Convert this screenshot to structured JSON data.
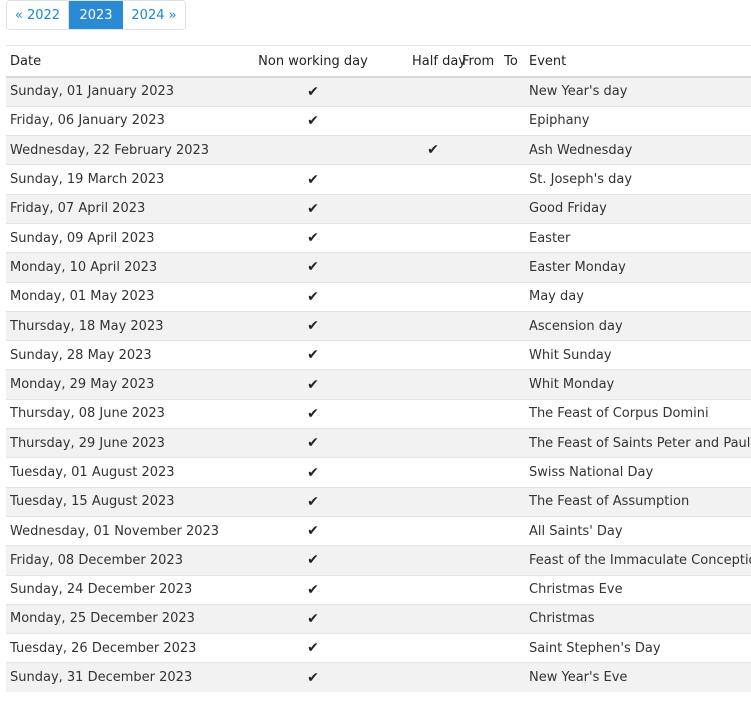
{
  "pagination": {
    "prev": "« 2022",
    "current": "2023",
    "next": "2024 »"
  },
  "table": {
    "headers": {
      "date": "Date",
      "non_working": "Non working day",
      "half_day": "Half day",
      "from": "From",
      "to": "To",
      "event": "Event"
    },
    "check_mark": "✔",
    "rows": [
      {
        "date": "Sunday, 01 January 2023",
        "non_working": "✔",
        "half_day": "",
        "from": "",
        "to": "",
        "event": "New Year's day"
      },
      {
        "date": "Friday, 06 January 2023",
        "non_working": "✔",
        "half_day": "",
        "from": "",
        "to": "",
        "event": "Epiphany"
      },
      {
        "date": "Wednesday, 22 February 2023",
        "non_working": "",
        "half_day": "✔",
        "from": "",
        "to": "",
        "event": "Ash Wednesday"
      },
      {
        "date": "Sunday, 19 March 2023",
        "non_working": "✔",
        "half_day": "",
        "from": "",
        "to": "",
        "event": "St. Joseph's day"
      },
      {
        "date": "Friday, 07 April 2023",
        "non_working": "✔",
        "half_day": "",
        "from": "",
        "to": "",
        "event": "Good Friday"
      },
      {
        "date": "Sunday, 09 April 2023",
        "non_working": "✔",
        "half_day": "",
        "from": "",
        "to": "",
        "event": "Easter"
      },
      {
        "date": "Monday, 10 April 2023",
        "non_working": "✔",
        "half_day": "",
        "from": "",
        "to": "",
        "event": "Easter Monday"
      },
      {
        "date": "Monday, 01 May 2023",
        "non_working": "✔",
        "half_day": "",
        "from": "",
        "to": "",
        "event": "May day"
      },
      {
        "date": "Thursday, 18 May 2023",
        "non_working": "✔",
        "half_day": "",
        "from": "",
        "to": "",
        "event": "Ascension day"
      },
      {
        "date": "Sunday, 28 May 2023",
        "non_working": "✔",
        "half_day": "",
        "from": "",
        "to": "",
        "event": "Whit Sunday"
      },
      {
        "date": "Monday, 29 May 2023",
        "non_working": "✔",
        "half_day": "",
        "from": "",
        "to": "",
        "event": "Whit Monday"
      },
      {
        "date": "Thursday, 08 June 2023",
        "non_working": "✔",
        "half_day": "",
        "from": "",
        "to": "",
        "event": "The Feast of Corpus Domini"
      },
      {
        "date": "Thursday, 29 June 2023",
        "non_working": "✔",
        "half_day": "",
        "from": "",
        "to": "",
        "event": "The Feast of Saints Peter and Paul"
      },
      {
        "date": "Tuesday, 01 August 2023",
        "non_working": "✔",
        "half_day": "",
        "from": "",
        "to": "",
        "event": "Swiss National Day"
      },
      {
        "date": "Tuesday, 15 August 2023",
        "non_working": "✔",
        "half_day": "",
        "from": "",
        "to": "",
        "event": "The Feast of Assumption"
      },
      {
        "date": "Wednesday, 01 November 2023",
        "non_working": "✔",
        "half_day": "",
        "from": "",
        "to": "",
        "event": "All Saints' Day"
      },
      {
        "date": "Friday, 08 December 2023",
        "non_working": "✔",
        "half_day": "",
        "from": "",
        "to": "",
        "event": "Feast of the Immaculate Conception"
      },
      {
        "date": "Sunday, 24 December 2023",
        "non_working": "✔",
        "half_day": "",
        "from": "",
        "to": "",
        "event": "Christmas Eve"
      },
      {
        "date": "Monday, 25 December 2023",
        "non_working": "✔",
        "half_day": "",
        "from": "",
        "to": "",
        "event": "Christmas"
      },
      {
        "date": "Tuesday, 26 December 2023",
        "non_working": "✔",
        "half_day": "",
        "from": "",
        "to": "",
        "event": "Saint Stephen's Day"
      },
      {
        "date": "Sunday, 31 December 2023",
        "non_working": "✔",
        "half_day": "",
        "from": "",
        "to": "",
        "event": "New Year's Eve"
      }
    ]
  },
  "colors": {
    "accent": "#2a8bd4",
    "link": "#1a8ad0",
    "stripe": "#f2f2f2"
  }
}
